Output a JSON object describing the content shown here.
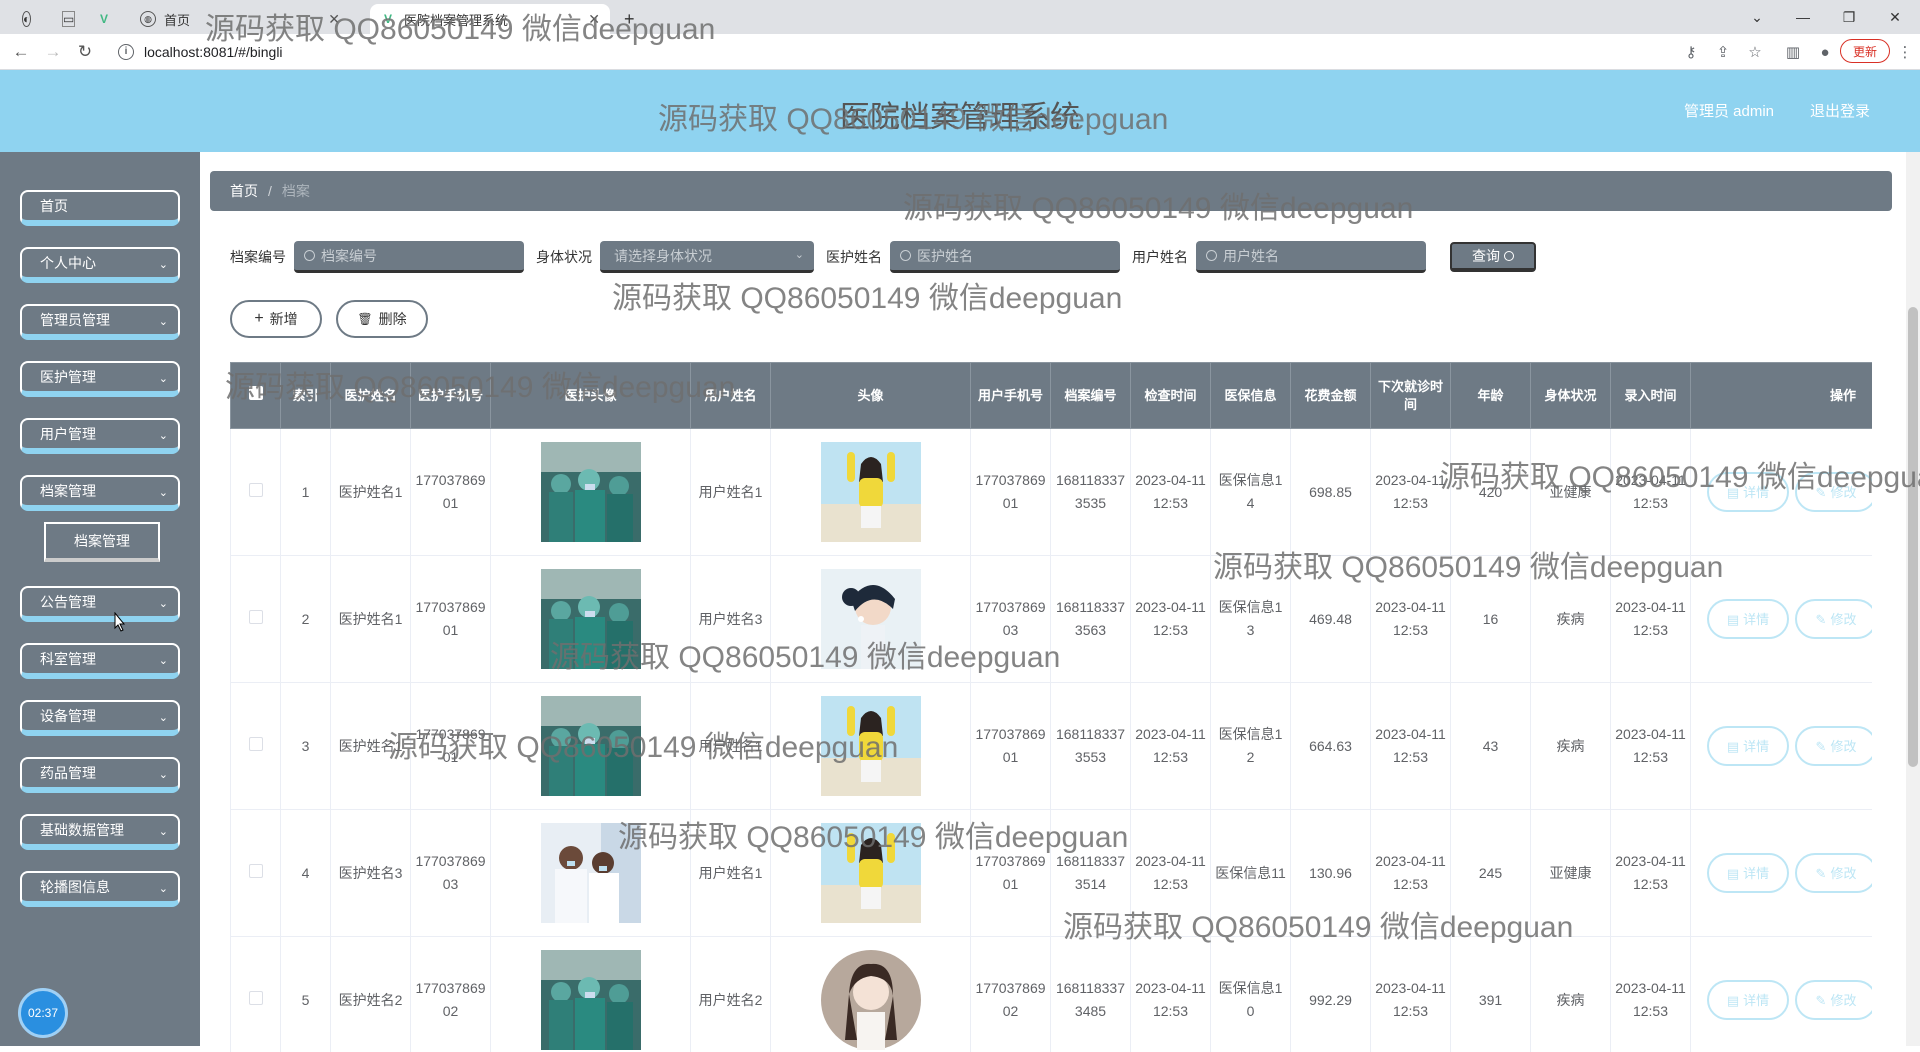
{
  "browser": {
    "tabs": [
      {
        "label": "首页",
        "active": false
      },
      {
        "label": "医院档案管理系统",
        "active": true
      }
    ],
    "url": "localhost:8081/#/bingli",
    "update_label": "更新"
  },
  "header": {
    "title": "医院档案管理系统",
    "user_label": "管理员 admin",
    "logout_label": "退出登录"
  },
  "sidebar": {
    "items": [
      {
        "label": "首页",
        "has_arrow": false
      },
      {
        "label": "个人中心",
        "has_arrow": true
      },
      {
        "label": "管理员管理",
        "has_arrow": true
      },
      {
        "label": "医护管理",
        "has_arrow": true
      },
      {
        "label": "用户管理",
        "has_arrow": true
      },
      {
        "label": "档案管理",
        "has_arrow": true
      },
      {
        "label": "公告管理",
        "has_arrow": true
      },
      {
        "label": "科室管理",
        "has_arrow": true
      },
      {
        "label": "设备管理",
        "has_arrow": true
      },
      {
        "label": "药品管理",
        "has_arrow": true
      },
      {
        "label": "基础数据管理",
        "has_arrow": true
      },
      {
        "label": "轮播图信息",
        "has_arrow": true
      }
    ],
    "submenu_label": "档案管理",
    "clock": "02:37"
  },
  "breadcrumb": {
    "home": "首页",
    "separator": "/",
    "current": "档案"
  },
  "search": {
    "fields": [
      {
        "label": "档案编号",
        "placeholder": "档案编号"
      },
      {
        "label": "身体状况",
        "placeholder": "请选择身体状况"
      },
      {
        "label": "医护姓名",
        "placeholder": "医护姓名"
      },
      {
        "label": "用户姓名",
        "placeholder": "用户姓名"
      }
    ],
    "query_label": "查询"
  },
  "actions": {
    "add_label": "新增",
    "delete_label": "删除"
  },
  "table": {
    "headers": [
      "索引",
      "医护姓名",
      "医护手机号",
      "医护头像",
      "用户姓名",
      "头像",
      "用户手机号",
      "档案编号",
      "检查时间",
      "医保信息",
      "花费金额",
      "下次就诊时间",
      "年龄",
      "身体状况",
      "录入时间",
      "操作"
    ],
    "detail_label": "详情",
    "edit_label": "修改",
    "rows": [
      {
        "index": "1",
        "doctor_name": "医护姓名1",
        "doctor_phone": "17703786901",
        "doctor_photo": "surgeons",
        "user_name": "用户姓名1",
        "user_photo": "yellow",
        "user_phone": "17703786901",
        "record_no": "1681183373535",
        "check_time": "2023-04-11 12:53",
        "insurance": "医保信息14",
        "cost": "698.85",
        "next_visit": "2023-04-11 12:53",
        "age": "420",
        "condition": "亚健康",
        "entry_time": "2023-04-11 12:53"
      },
      {
        "index": "2",
        "doctor_name": "医护姓名1",
        "doctor_phone": "17703786901",
        "doctor_photo": "surgeons",
        "user_name": "用户姓名3",
        "user_photo": "portrait",
        "user_phone": "17703786903",
        "record_no": "1681183373563",
        "check_time": "2023-04-11 12:53",
        "insurance": "医保信息13",
        "cost": "469.48",
        "next_visit": "2023-04-11 12:53",
        "age": "16",
        "condition": "疾病",
        "entry_time": "2023-04-11 12:53"
      },
      {
        "index": "3",
        "doctor_name": "医护姓名1",
        "doctor_phone": "17703786901",
        "doctor_photo": "surgeons",
        "user_name": "用户姓名1",
        "user_photo": "yellow",
        "user_phone": "17703786901",
        "record_no": "1681183373553",
        "check_time": "2023-04-11 12:53",
        "insurance": "医保信息12",
        "cost": "664.63",
        "next_visit": "2023-04-11 12:53",
        "age": "43",
        "condition": "疾病",
        "entry_time": "2023-04-11 12:53"
      },
      {
        "index": "4",
        "doctor_name": "医护姓名3",
        "doctor_phone": "17703786903",
        "doctor_photo": "nurses",
        "user_name": "用户姓名1",
        "user_photo": "yellow",
        "user_phone": "17703786901",
        "record_no": "1681183373514",
        "check_time": "2023-04-11 12:53",
        "insurance": "医保信息11",
        "cost": "130.96",
        "next_visit": "2023-04-11 12:53",
        "age": "245",
        "condition": "亚健康",
        "entry_time": "2023-04-11 12:53"
      },
      {
        "index": "5",
        "doctor_name": "医护姓名2",
        "doctor_phone": "17703786902",
        "doctor_photo": "surgeons",
        "user_name": "用户姓名2",
        "user_photo": "drawing",
        "user_phone": "17703786902",
        "record_no": "1681183373485",
        "check_time": "2023-04-11 12:53",
        "insurance": "医保信息10",
        "cost": "992.29",
        "next_visit": "2023-04-11 12:53",
        "age": "391",
        "condition": "疾病",
        "entry_time": "2023-04-11 12:53"
      }
    ]
  },
  "watermark": "源码获取 QQ86050149 微信deepguan",
  "colors": {
    "header_bg": "#8fd3f0",
    "sidebar_bg": "#6e7a85",
    "accent": "#8fd3f0",
    "pill": "#bde6f5"
  }
}
